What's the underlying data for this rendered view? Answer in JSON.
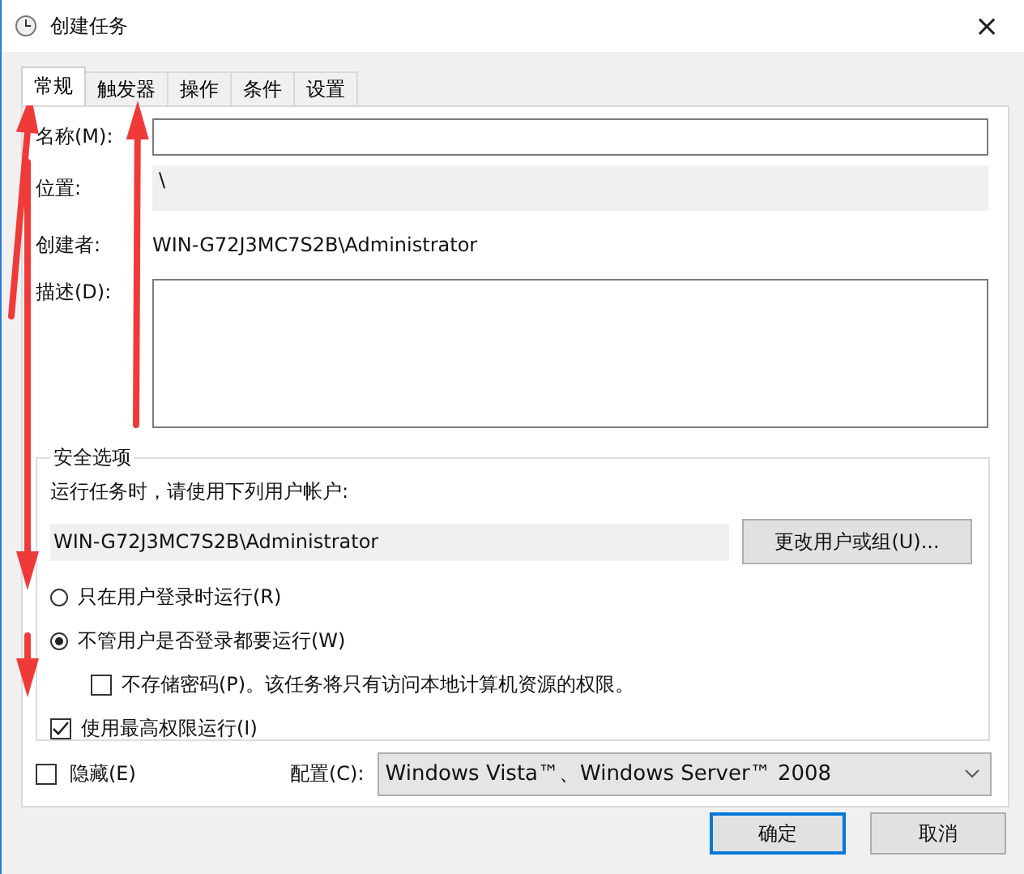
{
  "window": {
    "title": "创建任务",
    "close": "×"
  },
  "tabs": [
    {
      "label": "常规",
      "selected": true
    },
    {
      "label": "触发器",
      "selected": false
    },
    {
      "label": "操作",
      "selected": false
    },
    {
      "label": "条件",
      "selected": false
    },
    {
      "label": "设置",
      "selected": false
    }
  ],
  "general": {
    "name_label": "名称(M):",
    "location_label": "位置:",
    "location_value": "\\",
    "author_label": "创建者:",
    "author_value": "WIN-G72J3MC7S2B\\Administrator",
    "description_label": "描述(D):"
  },
  "security": {
    "title": "安全选项",
    "run_as_label": "运行任务时，请使用下列用户帐户:",
    "account": "WIN-G72J3MC7S2B\\Administrator",
    "change_button": "更改用户或组(U)...",
    "options": [
      {
        "kind": "radio",
        "label": "只在用户登录时运行(R)",
        "selected": false
      },
      {
        "kind": "radio",
        "label": "不管用户是否登录都要运行(W)",
        "selected": true,
        "children": [
          {
            "kind": "checkbox",
            "label": "不存储密码(P)。该任务将只有访问本地计算机资源的权限。",
            "checked": false
          }
        ]
      },
      {
        "kind": "checkbox",
        "label": "使用最高权限运行(I)",
        "checked": true
      }
    ]
  },
  "hidden": {
    "label": "隐藏(E)",
    "checked": false
  },
  "configure": {
    "label": "配置(C):",
    "value": "Windows Vista™、Windows Server™ 2008"
  },
  "buttons": [
    {
      "label": "确定",
      "default": true
    },
    {
      "label": "取消",
      "default": false
    }
  ]
}
